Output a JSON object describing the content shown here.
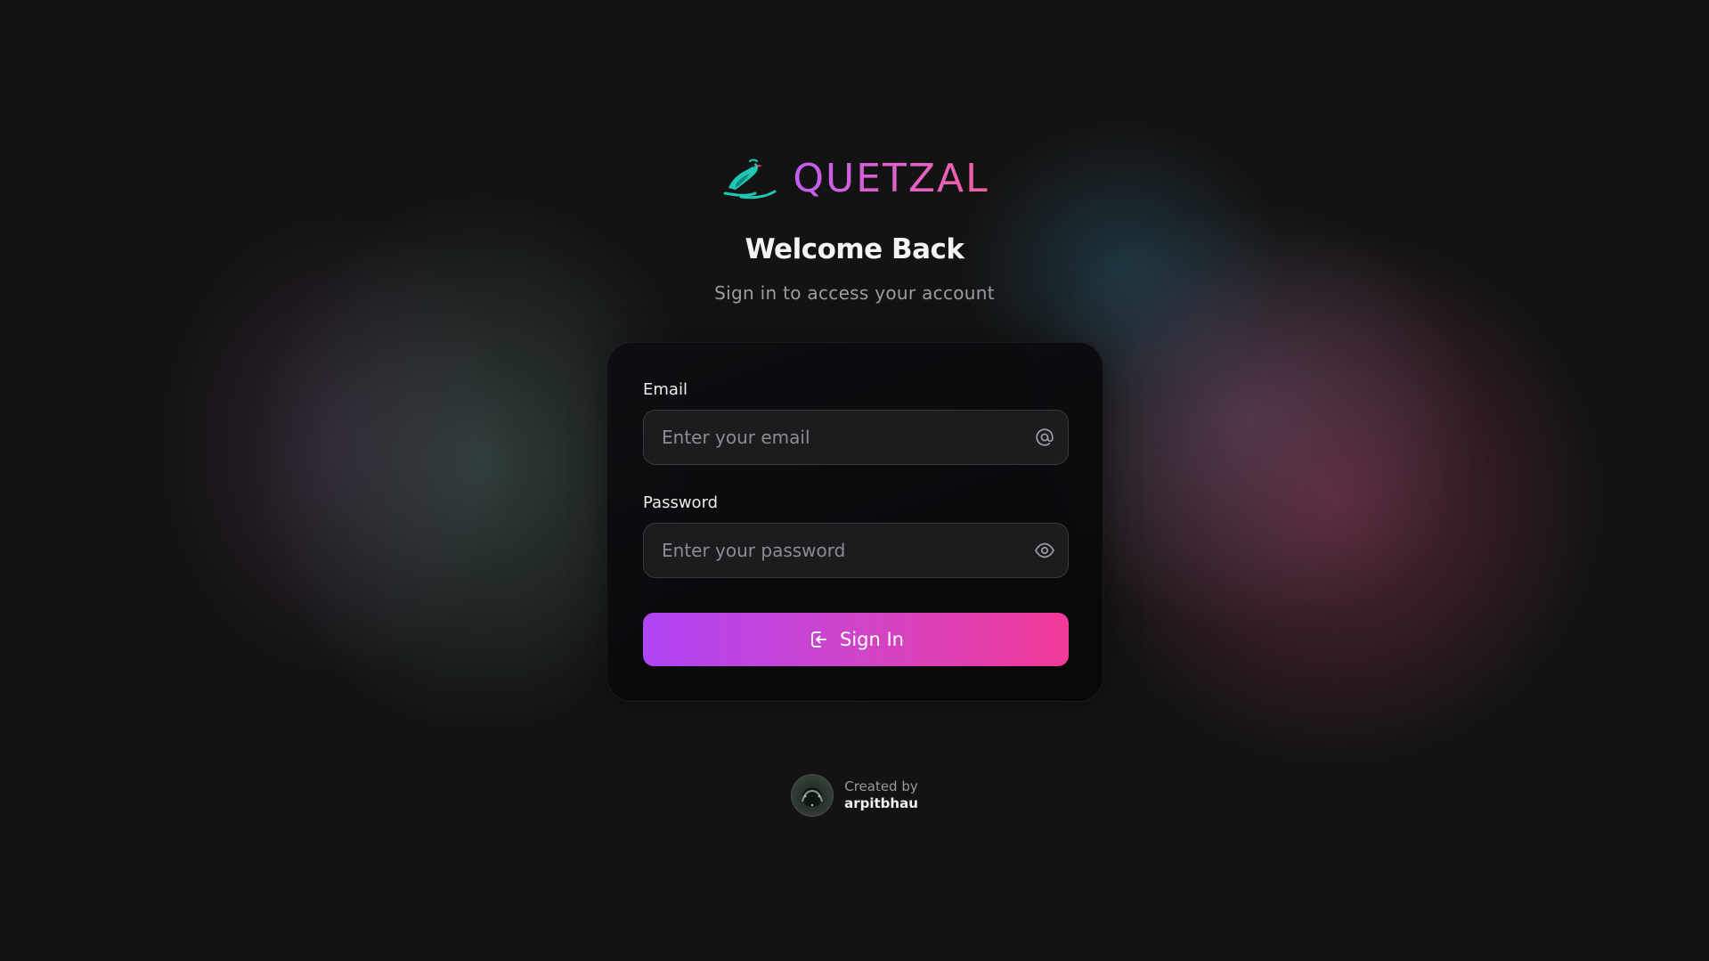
{
  "brand": {
    "name": "QUETZAL",
    "icon": "quetzal-bird-logo",
    "colors": {
      "text_from": "#c15df0",
      "text_to": "#f0609f",
      "bird": "#1fc8b4"
    }
  },
  "header": {
    "title": "Welcome Back",
    "subtitle": "Sign in to access your account"
  },
  "form": {
    "email": {
      "label": "Email",
      "placeholder": "Enter your email",
      "value": "",
      "icon": "at-sign-icon"
    },
    "password": {
      "label": "Password",
      "placeholder": "Enter your password",
      "value": "",
      "icon": "eye-icon"
    },
    "submit": {
      "label": "Sign In",
      "icon": "login-icon",
      "gradient_from": "#b045f6",
      "gradient_to": "#f23a98"
    }
  },
  "footer": {
    "created_by_label": "Created by",
    "author": "arpitbhau"
  }
}
